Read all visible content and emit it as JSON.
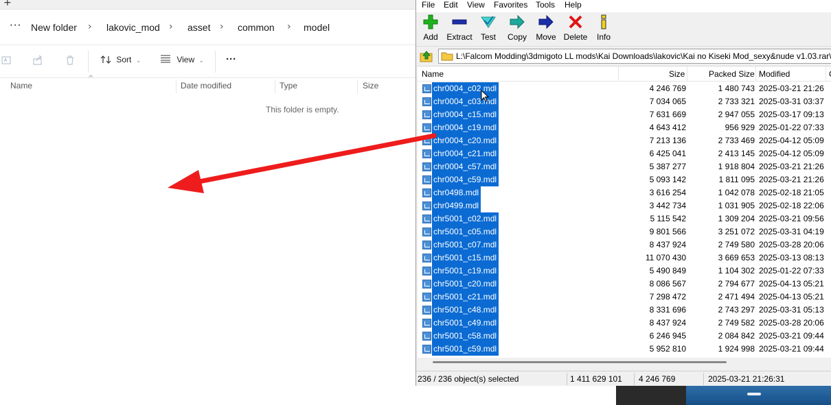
{
  "explorer": {
    "breadcrumbs": [
      "New folder",
      "lakovic_mod",
      "asset",
      "common",
      "model"
    ],
    "more_label": "···",
    "commands": {
      "sort_label": "Sort",
      "view_label": "View",
      "more_label": "···"
    },
    "columns": [
      "Name",
      "Date modified",
      "Type",
      "Size"
    ],
    "empty_message": "This folder is empty."
  },
  "annotation": {
    "arrow_color": "#ee1c1c"
  },
  "winrar": {
    "menu": [
      "File",
      "Edit",
      "View",
      "Favorites",
      "Tools",
      "Help"
    ],
    "toolbar": [
      {
        "label": "Add",
        "icon": "add-icon"
      },
      {
        "label": "Extract",
        "icon": "extract-icon"
      },
      {
        "label": "Test",
        "icon": "test-icon"
      },
      {
        "label": "Copy",
        "icon": "copy-icon"
      },
      {
        "label": "Move",
        "icon": "move-icon"
      },
      {
        "label": "Delete",
        "icon": "delete-icon"
      },
      {
        "label": "Info",
        "icon": "info-icon"
      }
    ],
    "path": "L:\\Falcom Modding\\3dmigoto LL mods\\Kai Downloads\\lakovic\\Kai no Kiseki Mod_sexy&nude v1.03.rar\\",
    "columns": [
      "Name",
      "Size",
      "Packed Size",
      "Modified",
      "C"
    ],
    "files": [
      {
        "name": "chr0004_c02.mdl",
        "size": "4 246 769",
        "packed": "1 480 743",
        "modified": "2025-03-21 21:26"
      },
      {
        "name": "chr0004_c03.mdl",
        "size": "7 034 065",
        "packed": "2 733 321",
        "modified": "2025-03-31 03:37"
      },
      {
        "name": "chr0004_c15.mdl",
        "size": "7 631 669",
        "packed": "2 947 055",
        "modified": "2025-03-17 09:13"
      },
      {
        "name": "chr0004_c19.mdl",
        "size": "4 643 412",
        "packed": "956 929",
        "modified": "2025-01-22 07:33"
      },
      {
        "name": "chr0004_c20.mdl",
        "size": "7 213 136",
        "packed": "2 733 469",
        "modified": "2025-04-12 05:09"
      },
      {
        "name": "chr0004_c21.mdl",
        "size": "6 425 041",
        "packed": "2 413 145",
        "modified": "2025-04-12 05:09"
      },
      {
        "name": "chr0004_c57.mdl",
        "size": "5 387 277",
        "packed": "1 918 804",
        "modified": "2025-03-21 21:26"
      },
      {
        "name": "chr0004_c59.mdl",
        "size": "5 093 142",
        "packed": "1 811 095",
        "modified": "2025-03-21 21:26"
      },
      {
        "name": "chr0498.mdl",
        "size": "3 616 254",
        "packed": "1 042 078",
        "modified": "2025-02-18 21:05"
      },
      {
        "name": "chr0499.mdl",
        "size": "3 442 734",
        "packed": "1 031 905",
        "modified": "2025-02-18 22:06"
      },
      {
        "name": "chr5001_c02.mdl",
        "size": "5 115 542",
        "packed": "1 309 204",
        "modified": "2025-03-21 09:56"
      },
      {
        "name": "chr5001_c05.mdl",
        "size": "9 801 566",
        "packed": "3 251 072",
        "modified": "2025-03-31 04:19"
      },
      {
        "name": "chr5001_c07.mdl",
        "size": "8 437 924",
        "packed": "2 749 580",
        "modified": "2025-03-28 20:06"
      },
      {
        "name": "chr5001_c15.mdl",
        "size": "11 070 430",
        "packed": "3 669 653",
        "modified": "2025-03-13 08:13"
      },
      {
        "name": "chr5001_c19.mdl",
        "size": "5 490 849",
        "packed": "1 104 302",
        "modified": "2025-01-22 07:33"
      },
      {
        "name": "chr5001_c20.mdl",
        "size": "8 086 567",
        "packed": "2 794 677",
        "modified": "2025-04-13 05:21"
      },
      {
        "name": "chr5001_c21.mdl",
        "size": "7 298 472",
        "packed": "2 471 494",
        "modified": "2025-04-13 05:21"
      },
      {
        "name": "chr5001_c48.mdl",
        "size": "8 331 696",
        "packed": "2 743 297",
        "modified": "2025-03-31 05:13"
      },
      {
        "name": "chr5001_c49.mdl",
        "size": "8 437 924",
        "packed": "2 749 582",
        "modified": "2025-03-28 20:06"
      },
      {
        "name": "chr5001_c58.mdl",
        "size": "6 246 945",
        "packed": "2 084 842",
        "modified": "2025-03-21 09:44"
      },
      {
        "name": "chr5001_c59.mdl",
        "size": "5 952 810",
        "packed": "1 924 998",
        "modified": "2025-03-21 09:44"
      }
    ],
    "status": {
      "selected": "236 / 236 object(s) selected",
      "total_size": "1 411 629 101",
      "item_size": "4 246 769",
      "item_date": "2025-03-21 21:26:31"
    },
    "selection_color": "#0b6bd3"
  }
}
